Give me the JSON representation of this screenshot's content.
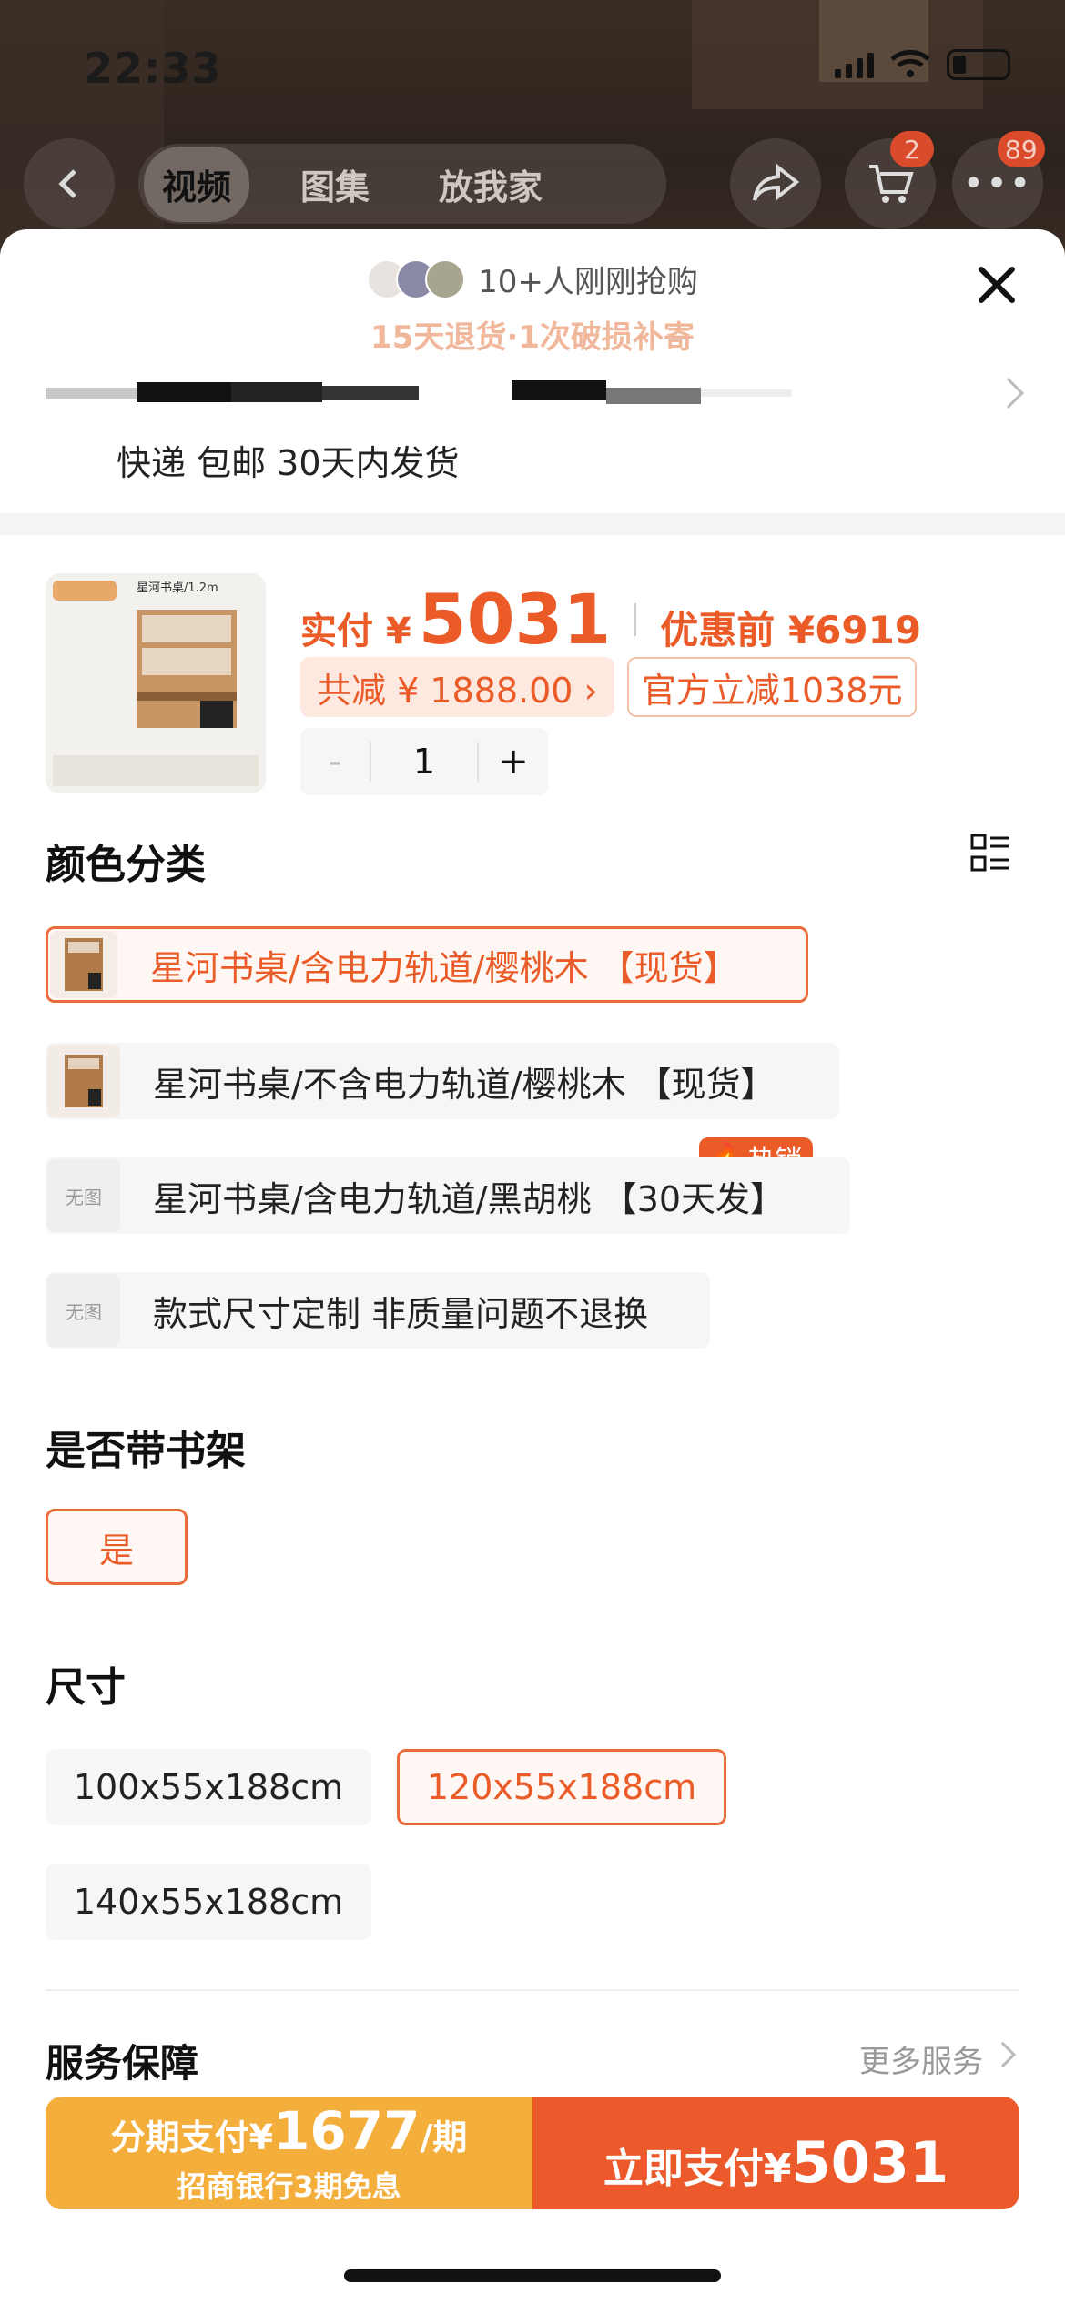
{
  "status_bar": {
    "time": "22:33"
  },
  "nav": {
    "tabs": [
      "视频",
      "图集",
      "放我家"
    ],
    "active_tab": "视频",
    "cart_badge": "2",
    "more_badge": "89"
  },
  "sheet": {
    "buyers_text": "10+人刚刚抢购",
    "guarantee_text": "15天退货·1次破损补寄",
    "shipping_text": "快递 包邮 30天内发货"
  },
  "product": {
    "thumb_title": "星河书桌/1.2m",
    "price_label": "实付 ¥",
    "price_value": "5031",
    "price_before": "优惠前 ¥6919",
    "discount_total": "共减 ¥ 1888.00 ›",
    "official_discount": "官方立减1038元",
    "quantity": "1",
    "qty_minus": "-",
    "qty_plus": "+"
  },
  "color_section": {
    "title": "颜色分类",
    "hot_tag": "热销",
    "no_image_label": "无图",
    "options": [
      "星河书桌/含电力轨道/樱桃木 【现货】",
      "星河书桌/不含电力轨道/樱桃木 【现货】",
      "星河书桌/含电力轨道/黑胡桃 【30天发】",
      "款式尺寸定制 非质量问题不退换"
    ]
  },
  "shelf_section": {
    "title": "是否带书架",
    "options": [
      "是"
    ]
  },
  "size_section": {
    "title": "尺寸",
    "options": [
      "100x55x188cm",
      "120x55x188cm",
      "140x55x188cm"
    ]
  },
  "service": {
    "title": "服务保障",
    "more": "更多服务"
  },
  "bottom": {
    "install_prefix": "分期支付¥",
    "install_amount": "1677",
    "install_suffix": "/期",
    "install_note": "招商银行3期免息",
    "pay_prefix": "立即支付¥",
    "pay_amount": "5031"
  },
  "colors": {
    "accent": "#EA5B28",
    "install_bg": "#F3AE3C",
    "pay_bg": "#EC5A2C"
  }
}
